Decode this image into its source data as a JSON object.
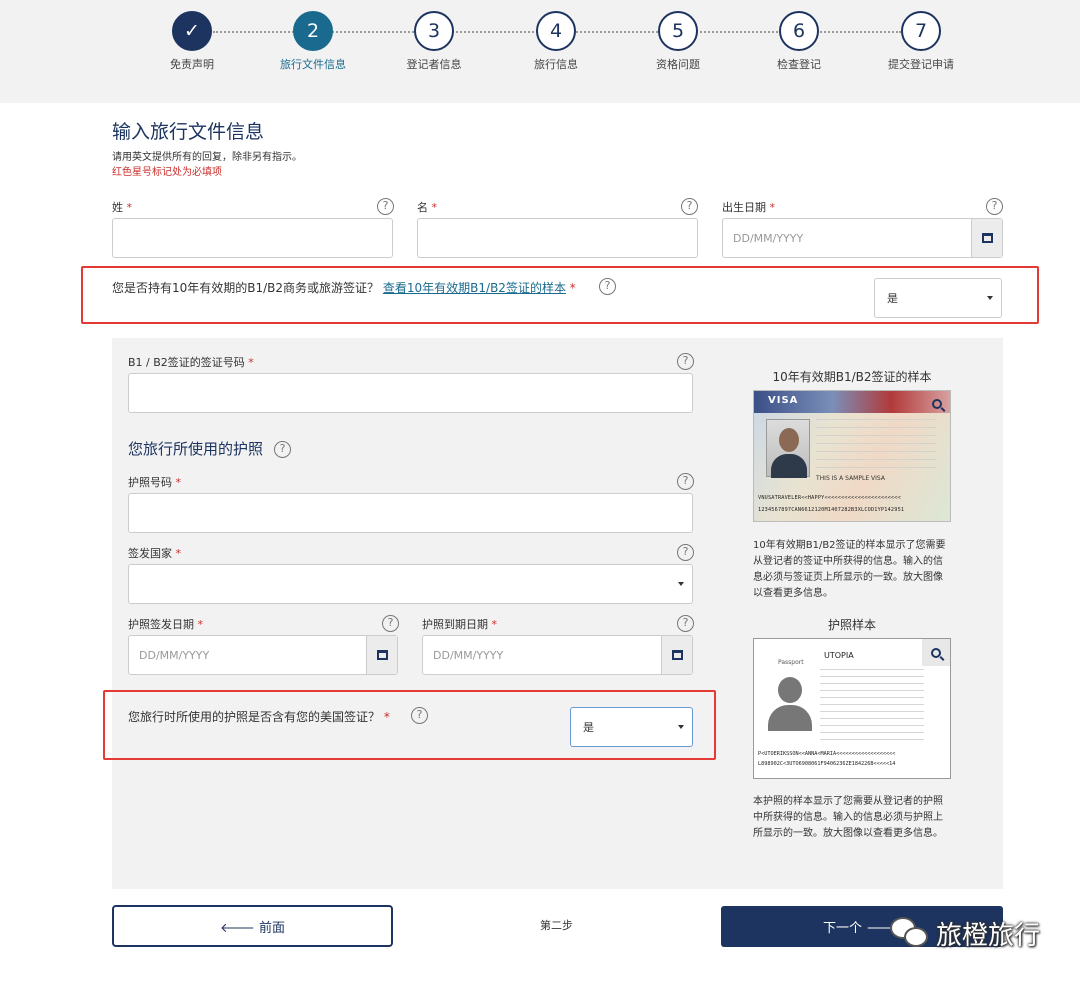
{
  "stepper": {
    "steps": [
      {
        "num": "✓",
        "label": "免责声明",
        "state": "done"
      },
      {
        "num": "2",
        "label": "旅行文件信息",
        "state": "active"
      },
      {
        "num": "3",
        "label": "登记者信息",
        "state": "todo"
      },
      {
        "num": "4",
        "label": "旅行信息",
        "state": "todo"
      },
      {
        "num": "5",
        "label": "资格问题",
        "state": "todo"
      },
      {
        "num": "6",
        "label": "检查登记",
        "state": "todo"
      },
      {
        "num": "7",
        "label": "提交登记申请",
        "state": "todo"
      }
    ]
  },
  "page": {
    "title": "输入旅行文件信息",
    "instruction": "请用英文提供所有的回复，除非另有指示。",
    "required_note": "红色星号标记处为必填项"
  },
  "fields": {
    "surname_label": "姓",
    "given_name_label": "名",
    "dob_label": "出生日期",
    "dob_placeholder": "DD/MM/YYYY",
    "visa_question": "您是否持有10年有效期的B1/B2商务或旅游签证？",
    "visa_sample_link": "查看10年有效期B1/B2签证的样本",
    "visa_answer": "是",
    "visa_number_label": "B1 / B2签证的签证号码",
    "passport_section_title": "您旅行所使用的护照",
    "passport_number_label": "护照号码",
    "issuing_country_label": "签发国家",
    "issue_date_label": "护照签发日期",
    "issue_date_placeholder": "DD/MM/YYYY",
    "expiry_date_label": "护照到期日期",
    "expiry_date_placeholder": "DD/MM/YYYY",
    "passport_visa_question": "您旅行时所使用的护照是否含有您的美国签证？",
    "passport_visa_answer": "是"
  },
  "help_glyph": "?",
  "required_mark": "*",
  "samples": {
    "visa_title": "10年有效期B1/B2签证的样本",
    "visa_text": "10年有效期B1/B2签证的样本显示了您需要从登记者的签证中所获得的信息。输入的信息必须与签证页上所显示的一致。放大图像以查看更多信息。",
    "visa_image_header": "VISA",
    "visa_image_mrz1": "VNUSATRAVELER<<HAPPY<<<<<<<<<<<<<<<<<<<<<<<",
    "visa_image_mrz2": "1234567897CAN6612120M1407282B3XLCOD1YP142951",
    "visa_image_sample": "THIS IS A SAMPLE VISA",
    "passport_title": "护照样本",
    "passport_text": "本护照的样本显示了您需要从登记者的护照中所获得的信息。输入的信息必须与护照上所显示的一致。放大图像以查看更多信息。",
    "passport_image_country": "UTOPIA",
    "passport_image_type": "Passport",
    "passport_image_mrz1": "P<UTOERIKSSON<<ANNA<MARIA<<<<<<<<<<<<<<<<<<<",
    "passport_image_mrz2": "L898902C<3UTO6908061F9406236ZE184226B<<<<<14"
  },
  "nav": {
    "prev_label": "🡐 前面",
    "step_text": "第二步",
    "next_label": "下一个 🡒"
  },
  "watermark": {
    "text": "旅橙旅行"
  },
  "colors": {
    "brand_navy": "#1d3460",
    "active_step": "#1a6a8f",
    "required_red": "#c9302c",
    "highlight_box": "#e53935"
  }
}
